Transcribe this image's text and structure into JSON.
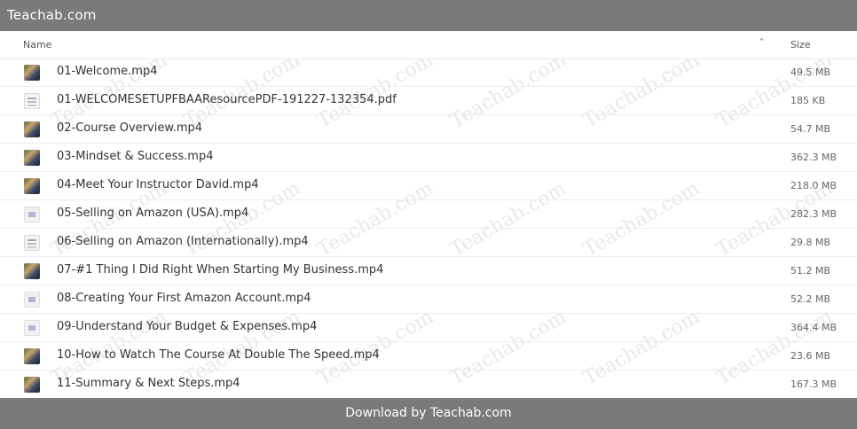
{
  "topbar": {
    "title": "Teachab.com"
  },
  "header": {
    "name_label": "Name",
    "sort_icon": "chevron-up-icon",
    "size_label": "Size"
  },
  "files": [
    {
      "name": "01-Welcome.mp4",
      "size": "49.5 MB",
      "thumb": "video"
    },
    {
      "name": "01-WELCOMESETUPFBAAResourcePDF-191227-132354.pdf",
      "size": "185 KB",
      "thumb": "doc"
    },
    {
      "name": "02-Course Overview.mp4",
      "size": "54.7 MB",
      "thumb": "video"
    },
    {
      "name": "03-Mindset & Success.mp4",
      "size": "362.3 MB",
      "thumb": "video"
    },
    {
      "name": "04-Meet Your Instructor David.mp4",
      "size": "218.0 MB",
      "thumb": "video"
    },
    {
      "name": "05-Selling on Amazon (USA).mp4",
      "size": "282.3 MB",
      "thumb": "pale"
    },
    {
      "name": "06-Selling on Amazon (Internationally).mp4",
      "size": "29.8 MB",
      "thumb": "doc"
    },
    {
      "name": "07-#1 Thing I Did Right When Starting My Business.mp4",
      "size": "51.2 MB",
      "thumb": "video"
    },
    {
      "name": "08-Creating Your First Amazon Account.mp4",
      "size": "52.2 MB",
      "thumb": "pale"
    },
    {
      "name": "09-Understand Your Budget & Expenses.mp4",
      "size": "364.4 MB",
      "thumb": "pale"
    },
    {
      "name": "10-How to Watch The Course At Double The Speed.mp4",
      "size": "23.6 MB",
      "thumb": "video"
    },
    {
      "name": "11-Summary & Next Steps.mp4",
      "size": "167.3 MB",
      "thumb": "video"
    }
  ],
  "footer": {
    "text": "Download by Teachab.com"
  },
  "watermark": {
    "text": "Teachab.com"
  }
}
